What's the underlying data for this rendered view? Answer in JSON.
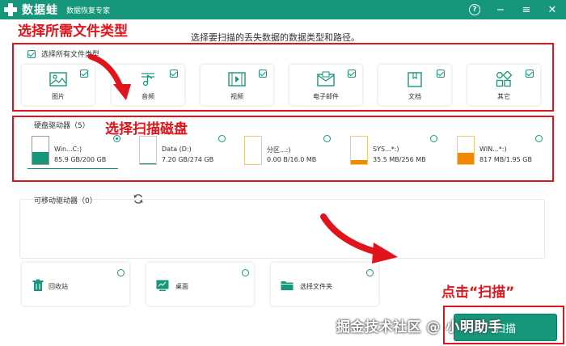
{
  "titlebar": {
    "app_name": "数据蛙",
    "subtitle": "数据恢复专家",
    "help_icon": "?",
    "minimize_icon": "−",
    "menu_icon": "≡",
    "close_icon": "✕"
  },
  "instruction": "选择要扫描的丢失数据的数据类型和路径。",
  "annotations": {
    "file_types": "选择所需文件类型",
    "disk": "选择扫描磁盘",
    "scan": "点击“扫描”"
  },
  "select_all": {
    "label": "选择所有文件类型",
    "checked": true
  },
  "file_types": [
    {
      "label": "图片",
      "icon": "image-icon",
      "checked": true
    },
    {
      "label": "音频",
      "icon": "music-icon",
      "checked": true
    },
    {
      "label": "视频",
      "icon": "video-icon",
      "checked": true
    },
    {
      "label": "电子邮件",
      "icon": "mail-icon",
      "checked": true
    },
    {
      "label": "文档",
      "icon": "document-icon",
      "checked": true
    },
    {
      "label": "其它",
      "icon": "other-icon",
      "checked": true
    }
  ],
  "hard_drives": {
    "title": "硬盘驱动器（5）",
    "drives": [
      {
        "name": "Win...C:)",
        "size": "85.9 GB/200 GB",
        "fill": 0.43,
        "color": "#16967a",
        "selected": true
      },
      {
        "name": "Data (D:)",
        "size": "7.20 GB/274 GB",
        "fill": 0.03,
        "color": "#16967a",
        "selected": false
      },
      {
        "name": "分区...:)",
        "size": "0.00  B/16.0 MB",
        "fill": 0.0,
        "color": "#f0a030",
        "selected": false
      },
      {
        "name": "SYS...*:)",
        "size": "35.5 MB/256 MB",
        "fill": 0.14,
        "color": "#f08a00",
        "selected": false
      },
      {
        "name": "WIN...*:)",
        "size": "817 MB/1.95 GB",
        "fill": 0.42,
        "color": "#f08a00",
        "selected": false
      }
    ]
  },
  "removable": {
    "title": "可移动驱动器（0）",
    "refresh_icon": "refresh-icon"
  },
  "locations": [
    {
      "label": "回收站",
      "icon": "trash-icon"
    },
    {
      "label": "桌面",
      "icon": "desktop-icon"
    },
    {
      "label": "选择文件夹",
      "icon": "folder-icon"
    }
  ],
  "scan_button": {
    "label": "扫描"
  },
  "watermark": "掘金技术社区 @ 小明助手",
  "colors": {
    "accent": "#16967a",
    "annotation": "#e2141b",
    "warning": "#f08a00"
  }
}
